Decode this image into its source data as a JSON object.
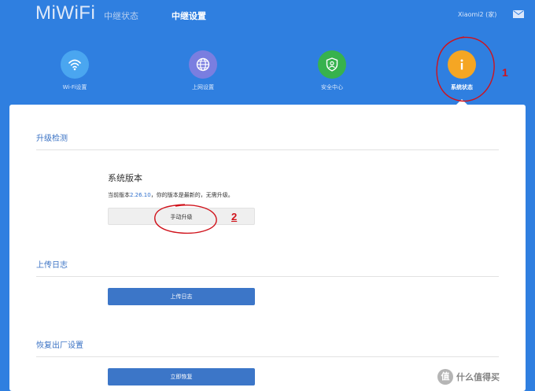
{
  "header": {
    "logo": "MiWiFi",
    "tabs": [
      {
        "label": "中继状态"
      },
      {
        "label": "中继设置"
      }
    ],
    "router_name": "Xiaomi2 (家)"
  },
  "icons": [
    {
      "label": "Wi-Fi设置",
      "icon": "wifi-icon",
      "color": "#4aa6f0"
    },
    {
      "label": "上网设置",
      "icon": "globe-icon",
      "color": "#7a7ee0"
    },
    {
      "label": "安全中心",
      "icon": "shield-icon",
      "color": "#37b24d"
    },
    {
      "label": "系统状态",
      "icon": "info-icon",
      "color": "#f5a623"
    }
  ],
  "upgrade": {
    "section_title": "升级检测",
    "version_title": "系统版本",
    "version_prefix": "当前版本",
    "version": "2.26.10",
    "version_suffix": "，你的版本是最新的，无需升级。",
    "manual_button": "手动升级"
  },
  "log": {
    "section_title": "上传日志",
    "button": "上传日志"
  },
  "reset": {
    "section_title": "恢复出厂设置",
    "button": "立即恢复"
  },
  "annotations": {
    "marker_1": "1",
    "marker_2": "2"
  },
  "watermark": {
    "icon_char": "值",
    "text": "什么值得买"
  },
  "colors": {
    "header_bg": "#2f7fe0",
    "accent_blue": "#3c76c8",
    "annotation_red": "#d0121b"
  }
}
